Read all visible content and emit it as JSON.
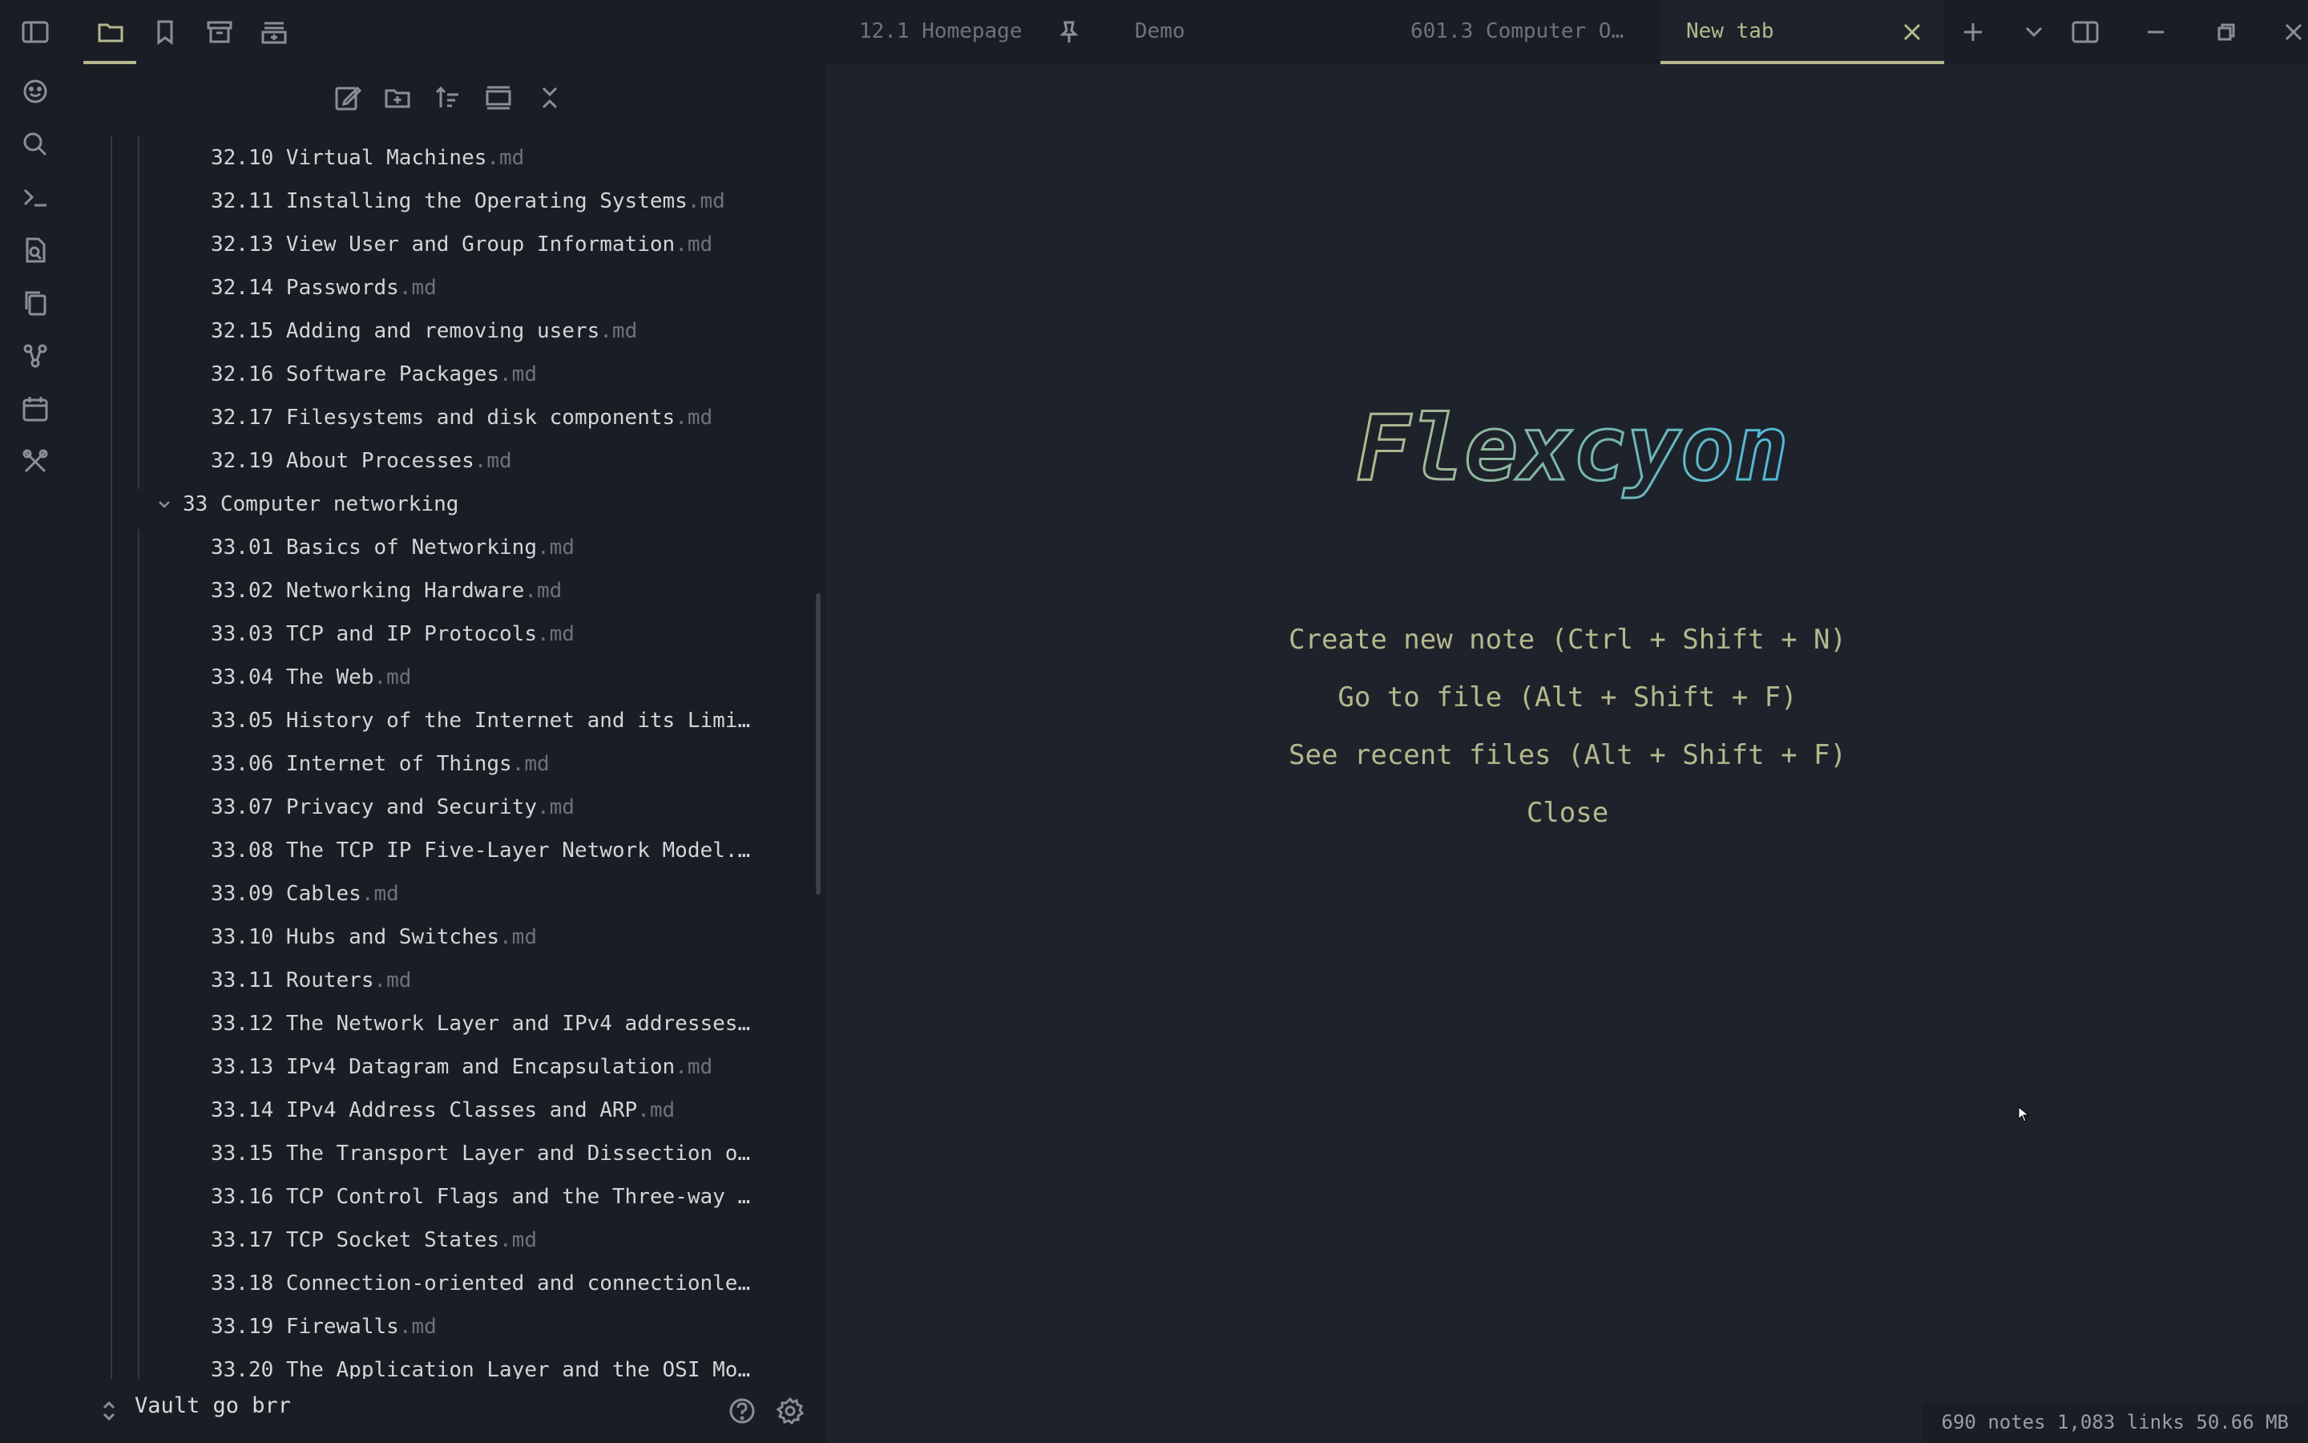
{
  "ribbon": {
    "icons": [
      "sidebar-toggle-icon",
      "smiley-icon",
      "search-icon",
      "terminal-icon",
      "file-search-icon",
      "copy-icon",
      "graph-icon",
      "calendar-icon",
      "tools-icon"
    ]
  },
  "sidebar": {
    "top_tabs": [
      "folder-icon",
      "bookmark-icon",
      "archive-icon",
      "stack-add-icon"
    ],
    "toolbar_icons": [
      "new-note-icon",
      "new-folder-icon",
      "sort-icon",
      "collapse-icon",
      "close-all-icon"
    ],
    "rows": [
      {
        "indent": 2,
        "name": "32.10 Virtual Machines",
        "ext": ".md"
      },
      {
        "indent": 2,
        "name": "32.11 Installing the Operating Systems",
        "ext": ".md"
      },
      {
        "indent": 2,
        "name": "32.13 View User and Group Information",
        "ext": ".md"
      },
      {
        "indent": 2,
        "name": "32.14 Passwords",
        "ext": ".md"
      },
      {
        "indent": 2,
        "name": "32.15 Adding and removing users",
        "ext": ".md"
      },
      {
        "indent": 2,
        "name": "32.16 Software Packages",
        "ext": ".md"
      },
      {
        "indent": 2,
        "name": "32.17 Filesystems and disk components",
        "ext": ".md"
      },
      {
        "indent": 2,
        "name": "32.19 About Processes",
        "ext": ".md"
      },
      {
        "indent": 1,
        "name": "33 Computer networking",
        "ext": "",
        "folder": true
      },
      {
        "indent": 2,
        "name": "33.01 Basics of Networking",
        "ext": ".md"
      },
      {
        "indent": 2,
        "name": "33.02 Networking Hardware",
        "ext": ".md"
      },
      {
        "indent": 2,
        "name": "33.03 TCP and IP Protocols",
        "ext": ".md"
      },
      {
        "indent": 2,
        "name": "33.04 The Web",
        "ext": ".md"
      },
      {
        "indent": 2,
        "name": "33.05 History of the Internet and its Limi…",
        "ext": ""
      },
      {
        "indent": 2,
        "name": "33.06 Internet of Things",
        "ext": ".md"
      },
      {
        "indent": 2,
        "name": "33.07 Privacy and Security",
        "ext": ".md"
      },
      {
        "indent": 2,
        "name": "33.08 The TCP IP Five-Layer Network Model.…",
        "ext": ""
      },
      {
        "indent": 2,
        "name": "33.09 Cables",
        "ext": ".md"
      },
      {
        "indent": 2,
        "name": "33.10 Hubs and Switches",
        "ext": ".md"
      },
      {
        "indent": 2,
        "name": "33.11 Routers",
        "ext": ".md"
      },
      {
        "indent": 2,
        "name": "33.12 The Network Layer and IPv4 addresses…",
        "ext": ""
      },
      {
        "indent": 2,
        "name": "33.13 IPv4 Datagram and Encapsulation",
        "ext": ".md"
      },
      {
        "indent": 2,
        "name": "33.14 IPv4 Address Classes and ARP",
        "ext": ".md"
      },
      {
        "indent": 2,
        "name": "33.15 The Transport Layer and Dissection o…",
        "ext": ""
      },
      {
        "indent": 2,
        "name": "33.16 TCP Control Flags and the Three-way …",
        "ext": ""
      },
      {
        "indent": 2,
        "name": "33.17 TCP Socket States",
        "ext": ".md"
      },
      {
        "indent": 2,
        "name": "33.18 Connection-oriented and connectionle…",
        "ext": ""
      },
      {
        "indent": 2,
        "name": "33.19 Firewalls",
        "ext": ".md"
      },
      {
        "indent": 2,
        "name": "33.20 The Application Layer and the OSI Mo…",
        "ext": ""
      }
    ],
    "vault_name": "Vault go brr"
  },
  "tabs": {
    "tab1": "12.1 Homepage",
    "tab2": "Demo",
    "tab3": "601.3 Computer O…",
    "active": "New tab"
  },
  "new_tab": {
    "logo_text": "Flexcyon",
    "actions": [
      "Create new note (Ctrl + Shift + N)",
      "Go to file (Alt + Shift + F)",
      "See recent files (Alt + Shift + F)",
      "Close"
    ]
  },
  "status_bar": "690 notes 1,083 links 50.66 MB",
  "colors": {
    "accent": "#b5b88d",
    "logo_cyan": "#4fb8d9",
    "bg": "#1e232b",
    "panel": "#1a1e24"
  }
}
